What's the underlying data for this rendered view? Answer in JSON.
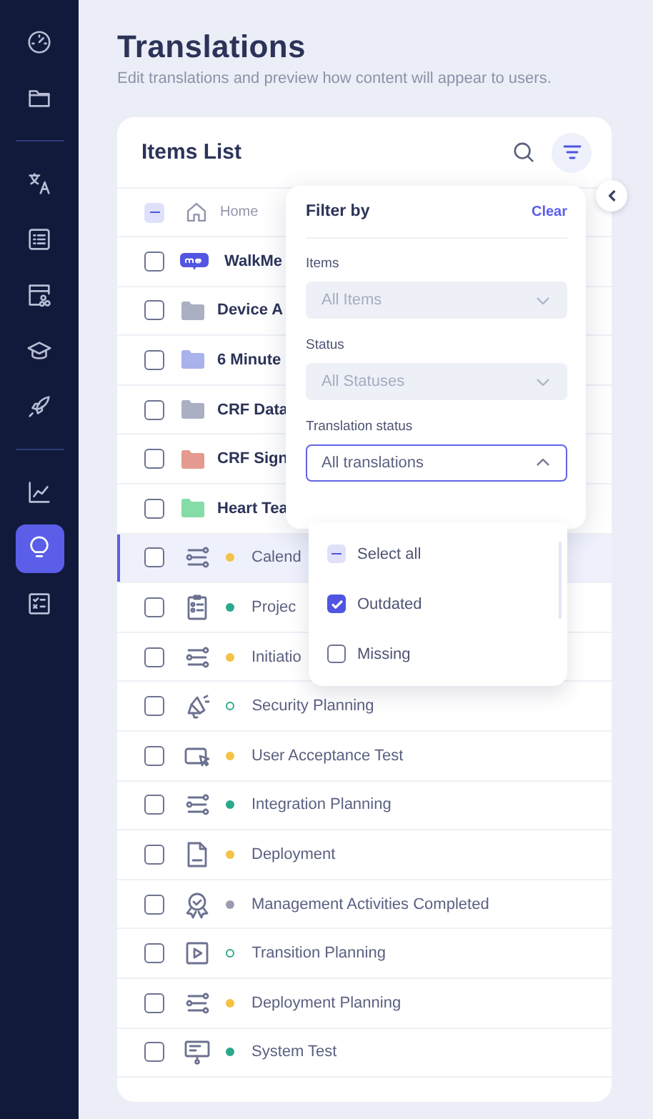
{
  "sidebar": {
    "groups": [
      [
        {
          "selected": false
        },
        {
          "selected": false
        }
      ],
      [
        {
          "selected": false
        },
        {
          "selected": false
        },
        {
          "selected": false
        },
        {
          "selected": false
        },
        {
          "selected": false
        }
      ],
      [
        {
          "selected": false
        },
        {
          "selected": true
        },
        {
          "selected": false
        }
      ]
    ]
  },
  "page": {
    "title": "Translations",
    "subtitle": "Edit translations and preview how content will appear to users."
  },
  "items_list": {
    "title": "Items List",
    "header": {
      "indeterminate": true,
      "breadcrumb": "Home"
    },
    "rows": [
      {
        "kind": "walkme",
        "label": "WalkMe",
        "checked": false,
        "selected": false
      },
      {
        "kind": "folder",
        "color": "#aab0c2",
        "label": "Device A",
        "checked": false,
        "selected": false
      },
      {
        "kind": "folder",
        "color": "#a9b2ea",
        "label": "6 Minute",
        "checked": false,
        "selected": false
      },
      {
        "kind": "folder",
        "color": "#aab0c2",
        "label": "CRF Data",
        "checked": false,
        "selected": false
      },
      {
        "kind": "folder",
        "color": "#e59a90",
        "label": "CRF Sign",
        "checked": false,
        "selected": false
      },
      {
        "kind": "folder",
        "color": "#84dca6",
        "label": "Heart Tea",
        "checked": false,
        "selected": false
      },
      {
        "kind": "flow",
        "status": {
          "color": "#f4c244",
          "kind": "filled"
        },
        "label": "Calend",
        "checked": false,
        "selected": true
      },
      {
        "kind": "checklist",
        "status": {
          "color": "#2aa98d",
          "kind": "filled"
        },
        "label": "Projec",
        "checked": false,
        "selected": false
      },
      {
        "kind": "flow",
        "status": {
          "color": "#f4c244",
          "kind": "filled"
        },
        "label": "Initiatio",
        "checked": false,
        "selected": false
      },
      {
        "kind": "megaphone",
        "status": {
          "color": "#2aa98d",
          "kind": "hollow"
        },
        "label": "Security Planning",
        "checked": false,
        "selected": false
      },
      {
        "kind": "launcher",
        "status": {
          "color": "#f4c244",
          "kind": "filled"
        },
        "label": "User Acceptance Test",
        "checked": false,
        "selected": false
      },
      {
        "kind": "flow",
        "status": {
          "color": "#2aa98d",
          "kind": "filled"
        },
        "label": "Integration Planning",
        "checked": false,
        "selected": false
      },
      {
        "kind": "document",
        "status": {
          "color": "#f4c244",
          "kind": "filled"
        },
        "label": "Deployment",
        "checked": false,
        "selected": false
      },
      {
        "kind": "badge",
        "status": {
          "color": "#9a9db0",
          "kind": "filled"
        },
        "label": "Management Activities Completed",
        "checked": false,
        "selected": false
      },
      {
        "kind": "video",
        "status": {
          "color": "#2aa98d",
          "kind": "hollow"
        },
        "label": "Transition Planning",
        "checked": false,
        "selected": false
      },
      {
        "kind": "flow",
        "status": {
          "color": "#f4c244",
          "kind": "filled"
        },
        "label": "Deployment Planning",
        "checked": false,
        "selected": false
      },
      {
        "kind": "tooltip",
        "status": {
          "color": "#2aa98d",
          "kind": "filled"
        },
        "label": "System Test",
        "checked": false,
        "selected": false
      }
    ]
  },
  "filter_panel": {
    "title": "Filter by",
    "clear": "Clear",
    "fields": [
      {
        "label": "Items",
        "value": "All Items",
        "expanded": false,
        "disabled": true
      },
      {
        "label": "Status",
        "value": "All Statuses",
        "expanded": false,
        "disabled": true
      },
      {
        "label": "Translation status",
        "value": "All translations",
        "expanded": true,
        "disabled": false
      }
    ],
    "options": [
      {
        "label": "Select all",
        "indeterminate": true
      },
      {
        "label": "Outdated",
        "checked": true
      },
      {
        "label": "Missing",
        "checked": false
      }
    ]
  }
}
